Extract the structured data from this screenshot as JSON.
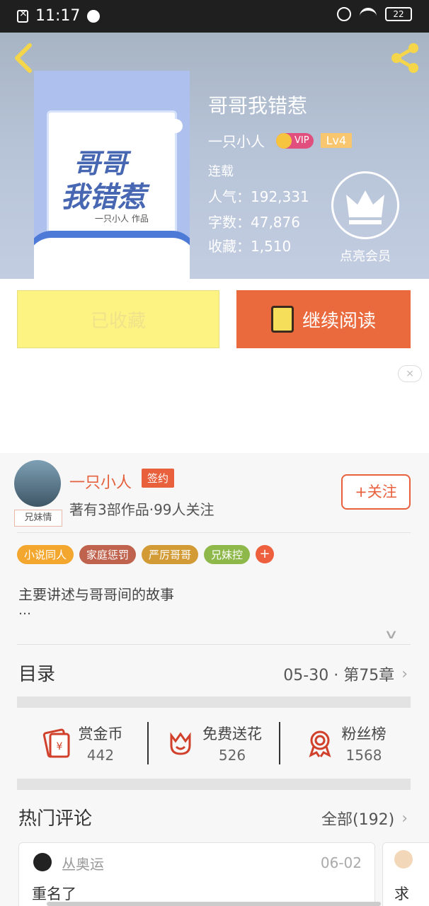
{
  "status_bar": {
    "time": "11:17",
    "battery": "22"
  },
  "book": {
    "title": "哥哥我错惹",
    "cover_title_line1": "哥哥",
    "cover_title_line2": "我错惹",
    "cover_author": "一只小人 作品",
    "author": "一只小人",
    "vip_label": "VIP",
    "level": "Lv4",
    "status": "连载",
    "popularity": "人气：192,331",
    "word_count": "字数：47,876",
    "favorites": "收藏：1,510",
    "member_label": "点亮会员"
  },
  "actions": {
    "collected_label": "已收藏",
    "read_label": "继续阅读"
  },
  "author_section": {
    "name": "一只小人",
    "signed_badge": "签约",
    "meta": "著有3部作品·99人关注",
    "avatar_badge": "兄妹情",
    "follow_label": "+关注",
    "tags": [
      {
        "label": "小说同人",
        "color": "#f3a72e"
      },
      {
        "label": "家庭惩罚",
        "color": "#c0634e"
      },
      {
        "label": "严厉哥哥",
        "color": "#d39b36"
      },
      {
        "label": "兄妹控",
        "color": "#8fb84a"
      }
    ],
    "tag_more": "+",
    "summary": "主要讲述与哥哥间的故事",
    "summary_more": "…"
  },
  "toc": {
    "title": "目录",
    "latest": "05-30 · 第75章"
  },
  "stats": [
    {
      "label": "赏金币",
      "value": "442",
      "icon": "red-envelope-icon"
    },
    {
      "label": "免费送花",
      "value": "526",
      "icon": "flower-icon"
    },
    {
      "label": "粉丝榜",
      "value": "1568",
      "icon": "medal-icon"
    }
  ],
  "comments": {
    "title": "热门评论",
    "all_label": "全部(192)",
    "items": [
      {
        "user": "丛奥运",
        "date": "06-02",
        "text": "重名了"
      },
      {
        "user": "",
        "date": "",
        "text": "求"
      }
    ]
  },
  "colors": {
    "accent": "#e8603c",
    "collect_bg": "#fcf382"
  }
}
